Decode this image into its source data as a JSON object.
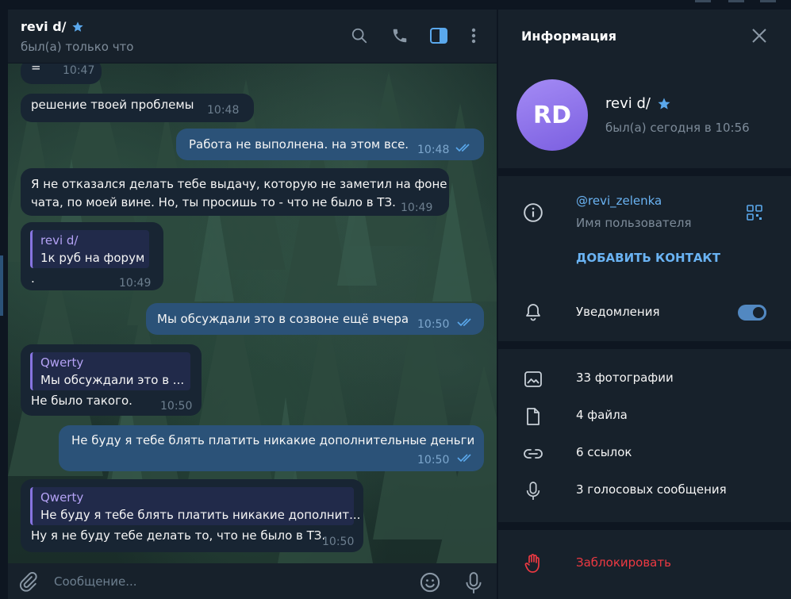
{
  "chat": {
    "name": "revi d/",
    "status": "был(а) только что"
  },
  "messages": [
    {
      "dir": "in",
      "text": "=",
      "time": "10:47"
    },
    {
      "dir": "in",
      "text": "решение твоей проблемы",
      "time": "10:48"
    },
    {
      "dir": "out",
      "text": "Работа не выполнена. на этом все.",
      "time": "10:48"
    },
    {
      "dir": "in",
      "text_line1": "Я не отказался делать тебе выдачу, которую не заметил на фоне",
      "text_line2": "чата, по моей вине. Но, ты просишь то - что не было в ТЗ.",
      "time": "10:49"
    },
    {
      "dir": "in",
      "reply_name": "revi d/",
      "reply_text": "1к руб на форум",
      "text": ".",
      "time": "10:49"
    },
    {
      "dir": "out",
      "text": "Мы обсуждали это в созвоне ещё вчера",
      "time": "10:50"
    },
    {
      "dir": "in",
      "reply_name": "Qwerty",
      "reply_text": "Мы обсуждали это в ...",
      "text": "Не было такого.",
      "time": "10:50"
    },
    {
      "dir": "out",
      "text": "Не буду я тебе блять платить никакие дополнительные деньги",
      "time": "10:50"
    },
    {
      "dir": "in",
      "reply_name": "Qwerty",
      "reply_text": "Не буду я тебе блять платить никакие дополнит...",
      "text": "Ну я не буду тебе делать то, что не было в ТЗ.",
      "time": "10:50"
    }
  ],
  "input": {
    "placeholder": "Сообщение..."
  },
  "panel": {
    "title": "Информация",
    "avatar_initials": "RD",
    "name": "revi d/",
    "status": "был(а) сегодня в 10:56",
    "username": "@revi_zelenka",
    "username_label": "Имя пользователя",
    "add_contact": "ДОБАВИТЬ КОНТАКТ",
    "notifications": "Уведомления",
    "notifications_on": true,
    "media": [
      {
        "icon": "photo-icon",
        "label": "33 фотографии"
      },
      {
        "icon": "file-icon",
        "label": "4 файла"
      },
      {
        "icon": "link-icon",
        "label": "6 ссылок"
      },
      {
        "icon": "microphone-icon",
        "label": "3 голосовых сообщения"
      }
    ],
    "block": "Заблокировать"
  },
  "colors": {
    "accent": "#6ab3f3",
    "outgoing_bubble": "#2b5278",
    "incoming_bubble": "#182533",
    "danger": "#ec3942",
    "avatar": "#8774e1"
  }
}
